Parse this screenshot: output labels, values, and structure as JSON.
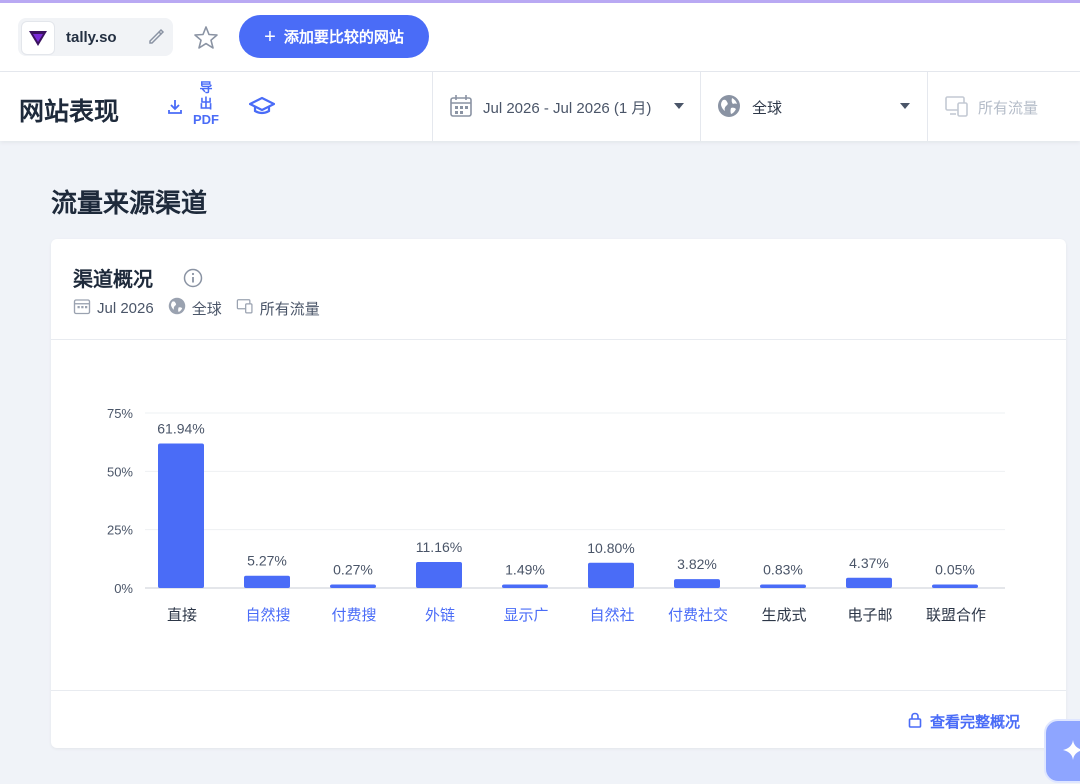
{
  "topbar": {
    "site_name": "tally.so",
    "add_compare_label": "添加要比较的网站"
  },
  "header": {
    "title": "网站表现",
    "export_label_line1": "导",
    "export_label_line2": "出",
    "export_label_line3": "PDF",
    "date_range": "Jul 2026 - Jul 2026 (1 月)",
    "region": "全球",
    "traffic": "所有流量"
  },
  "section": {
    "title": "流量来源渠道"
  },
  "card": {
    "title": "渠道概况",
    "meta_date": "Jul 2026",
    "meta_region": "全球",
    "meta_traffic": "所有流量",
    "footer_link": "查看完整概况"
  },
  "colors": {
    "accent": "#4a6cf7",
    "bar": "#4a6cf7"
  },
  "chart_data": {
    "type": "bar",
    "categories": [
      "直接",
      "自然搜索",
      "付费搜索",
      "外链",
      "显示广告",
      "自然社交",
      "付费社交",
      "生成式AI",
      "电子邮件",
      "联盟合作"
    ],
    "visible_labels": [
      "直接",
      "自然搜",
      "付费搜",
      "外链",
      "显示广",
      "自然社",
      "付费社交",
      "生成式",
      "电子邮",
      "联盟合作"
    ],
    "label_is_link": [
      false,
      true,
      true,
      true,
      true,
      true,
      true,
      false,
      false,
      false
    ],
    "values": [
      61.94,
      5.27,
      0.27,
      11.16,
      1.49,
      10.8,
      3.82,
      0.83,
      4.37,
      0.05
    ],
    "value_labels": [
      "61.94%",
      "5.27%",
      "0.27%",
      "11.16%",
      "1.49%",
      "10.80%",
      "3.82%",
      "0.83%",
      "4.37%",
      "0.05%"
    ],
    "yticks": [
      "0%",
      "25%",
      "50%",
      "75%"
    ],
    "ytick_values": [
      0,
      25,
      50,
      75
    ],
    "ylim": [
      0,
      75
    ],
    "grid": true,
    "legend": "none"
  }
}
